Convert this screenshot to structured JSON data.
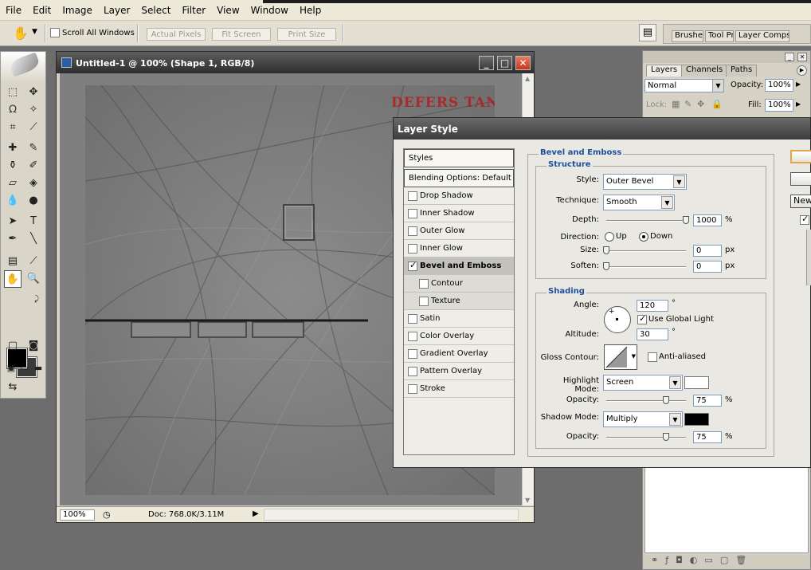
{
  "menu": [
    "File",
    "Edit",
    "Image",
    "Layer",
    "Select",
    "Filter",
    "View",
    "Window",
    "Help"
  ],
  "options": {
    "scroll_all_windows": "Scroll All Windows",
    "actual_pixels": "Actual Pixels",
    "fit_screen": "Fit Screen",
    "print_size": "Print Size",
    "well_tabs": [
      "Brushes",
      "Tool Pr",
      "Layer Comps"
    ]
  },
  "document": {
    "title": "Untitled-1 @ 100% (Shape 1, RGB/8)",
    "zoom": "100%",
    "doc_info": "Doc: 768.0K/3.11M",
    "canvas_text": "DEFERS TANK"
  },
  "layers_panel": {
    "tabs": [
      "Layers",
      "Channels",
      "Paths"
    ],
    "blend_mode": "Normal",
    "opacity_label": "Opacity:",
    "opacity": "100%",
    "lock_label": "Lock:",
    "fill_label": "Fill:",
    "fill": "100%"
  },
  "dialog": {
    "title": "Layer Style",
    "styles": [
      {
        "label": "Styles",
        "kind": "header"
      },
      {
        "label": "Blending Options: Default",
        "kind": "header"
      },
      {
        "label": "Drop Shadow",
        "checked": false
      },
      {
        "label": "Inner Shadow",
        "checked": false
      },
      {
        "label": "Outer Glow",
        "checked": false
      },
      {
        "label": "Inner Glow",
        "checked": false
      },
      {
        "label": "Bevel and Emboss",
        "checked": true,
        "selected": true
      },
      {
        "label": "Contour",
        "checked": false,
        "sub": true
      },
      {
        "label": "Texture",
        "checked": false,
        "sub": true
      },
      {
        "label": "Satin",
        "checked": false
      },
      {
        "label": "Color Overlay",
        "checked": false
      },
      {
        "label": "Gradient Overlay",
        "checked": false
      },
      {
        "label": "Pattern Overlay",
        "checked": false
      },
      {
        "label": "Stroke",
        "checked": false
      }
    ],
    "bevel": {
      "group_title": "Bevel and Emboss",
      "structure_title": "Structure",
      "style_label": "Style:",
      "style": "Outer Bevel",
      "technique_label": "Technique:",
      "technique": "Smooth",
      "depth_label": "Depth:",
      "depth": "1000",
      "depth_level": 1.0,
      "direction_label": "Direction:",
      "direction_up": "Up",
      "direction_down": "Down",
      "size_label": "Size:",
      "size": "0",
      "soften_label": "Soften:",
      "soften": "0",
      "percent": "%",
      "px": "px"
    },
    "shading": {
      "title": "Shading",
      "angle_label": "Angle:",
      "angle": "120",
      "degree": "°",
      "use_global_light": "Use Global Light",
      "altitude_label": "Altitude:",
      "altitude": "30",
      "gloss_contour_label": "Gloss Contour:",
      "anti_aliased": "Anti-aliased",
      "highlight_mode_label": "Highlight Mode:",
      "highlight_mode": "Screen",
      "highlight_color": "#ffffff",
      "opacity_label": "Opacity:",
      "highlight_opacity": "75",
      "shadow_mode_label": "Shadow Mode:",
      "shadow_mode": "Multiply",
      "shadow_color": "#000000",
      "shadow_opacity": "75"
    },
    "buttons": {
      "new": "New"
    }
  }
}
